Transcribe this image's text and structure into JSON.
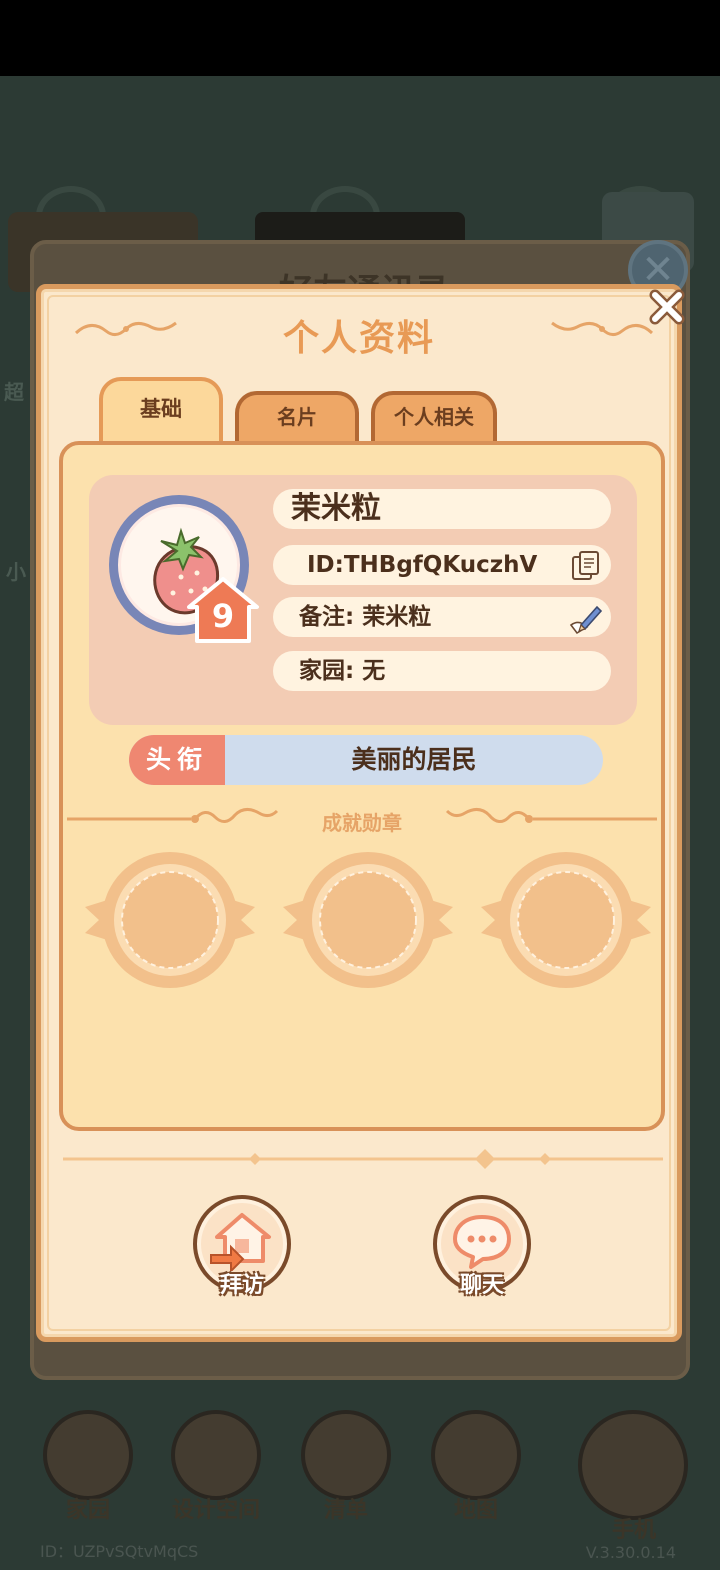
{
  "background": {
    "panel_title": "好友通讯录",
    "side_labels": [
      "超",
      "小"
    ],
    "nav": [
      "家园",
      "设计空间",
      "清单",
      "地图",
      "手机"
    ],
    "user_id": "ID：UZPvSQtvMqCS",
    "version": "V.3.30.0.14"
  },
  "dialog": {
    "title": "个人资料",
    "tabs": [
      {
        "label": "基础",
        "active": true
      },
      {
        "label": "名片",
        "active": false
      },
      {
        "label": "个人相关",
        "active": false
      }
    ],
    "profile": {
      "name": "茉米粒",
      "id": "ID:THBgfQKuczhV",
      "remark": "备注: 茉米粒",
      "home": "家园: 无",
      "level": "9",
      "avatar_icon": "strawberry-icon"
    },
    "title_bar": {
      "label": "头衔",
      "value": "美丽的居民"
    },
    "achievements": {
      "label": "成就勋章",
      "slots": 3
    },
    "actions": [
      {
        "label": "拜访",
        "icon": "visit-home-icon"
      },
      {
        "label": "聊天",
        "icon": "chat-bubble-icon"
      }
    ]
  },
  "colors": {
    "dialog_bg": "#fbe8cc",
    "accent_orange": "#e89a55",
    "title_label_red": "#ef8771",
    "title_value_blue": "#cfdced",
    "text_brown": "#4b2f1c"
  }
}
